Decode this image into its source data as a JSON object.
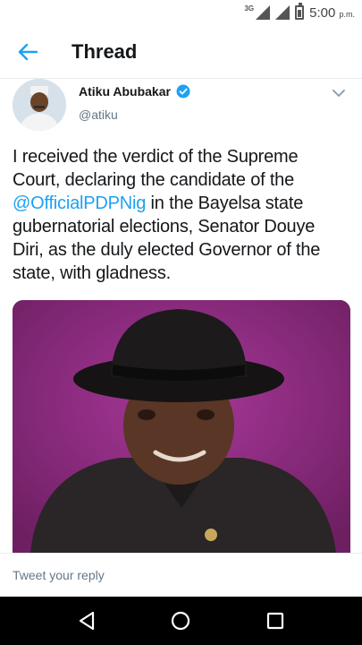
{
  "status_bar": {
    "network": "3G",
    "time": "5:00",
    "ampm": "p.m."
  },
  "header": {
    "title": "Thread",
    "back_icon": "arrow-left-icon",
    "accent_color": "#1da1f2"
  },
  "tweet": {
    "author_name": "Atiku Abubakar",
    "handle": "@atiku",
    "verified_icon": "verified-badge-icon",
    "text_before": "I received the verdict of the Supreme Court, declaring the candidate of the ",
    "mention": "@OfficialPDPNig",
    "text_after": " in the Bayelsa state gubernatorial elections, Senator Douye Diri, as the duly elected Governor of the state, with gladness."
  },
  "reply": {
    "placeholder": "Tweet your reply"
  },
  "nav": {
    "back_icon": "triangle-back-icon",
    "home_icon": "circle-home-icon",
    "recents_icon": "square-recents-icon"
  }
}
